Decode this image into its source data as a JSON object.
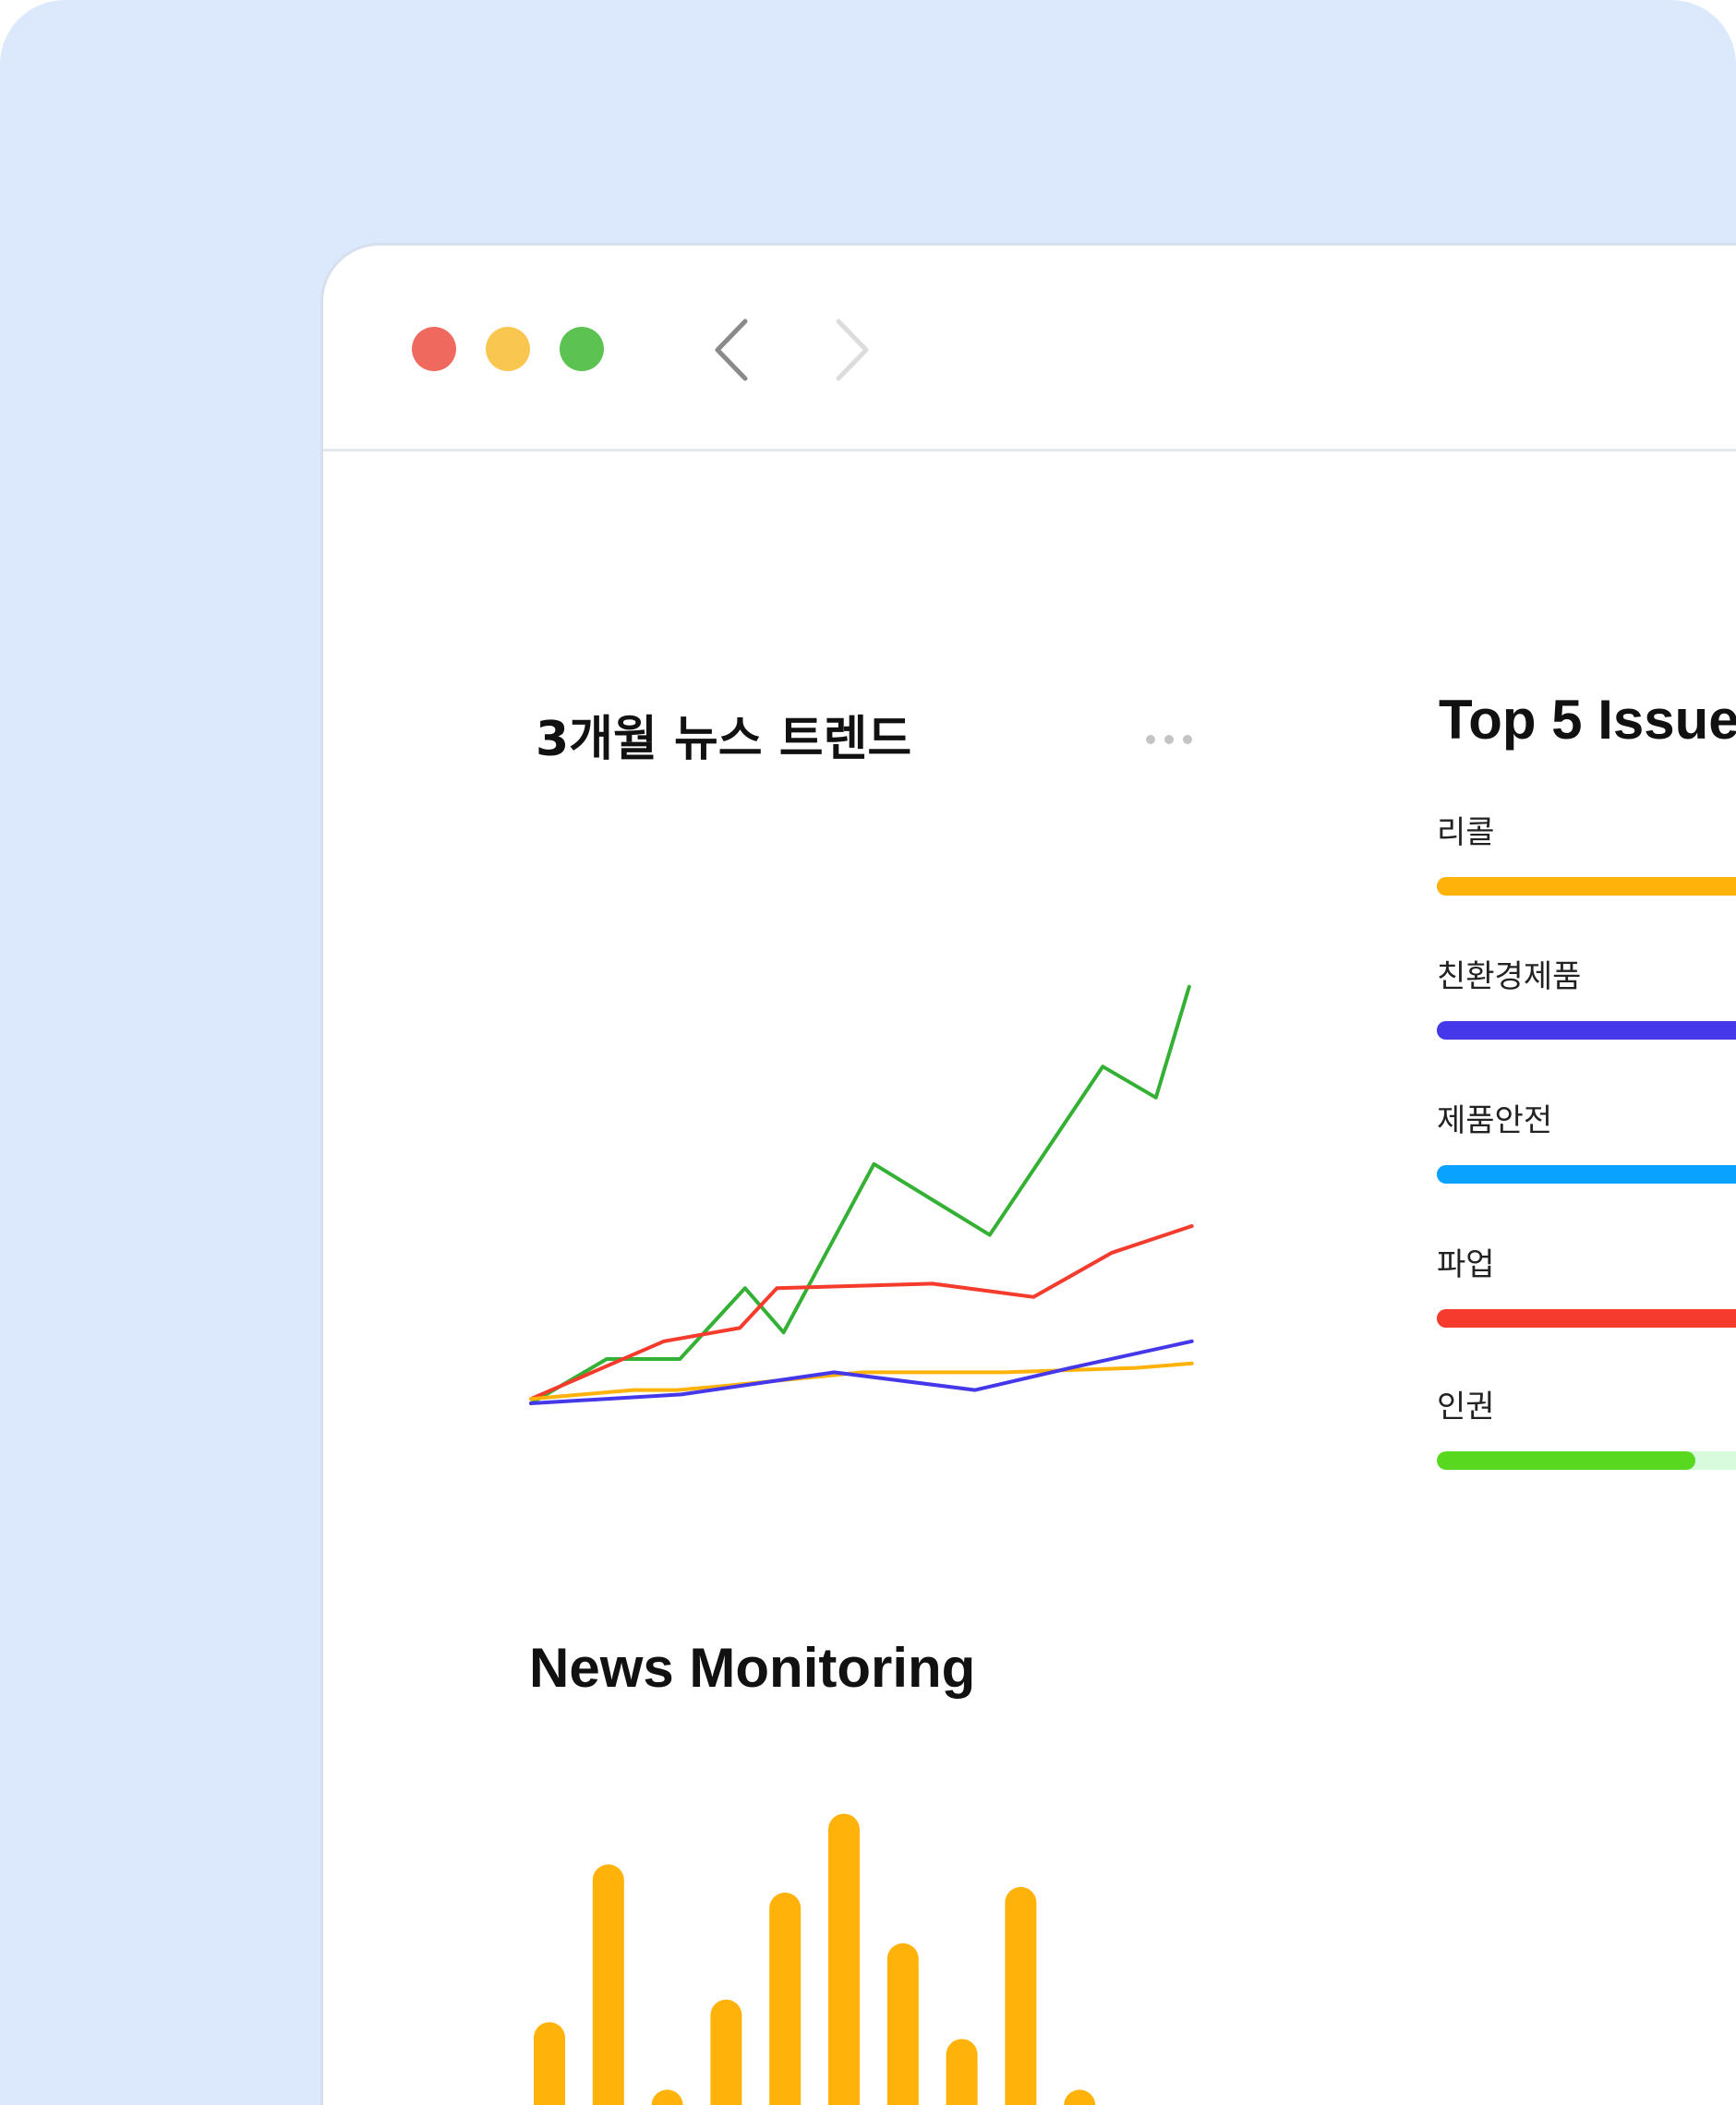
{
  "colors": {
    "background": "#dce9fd",
    "window": "#ffffff",
    "close": "#f0695e",
    "minimize": "#f9c64f",
    "maximize": "#5cc352"
  },
  "toolbar": {
    "back_icon": "chevron-left-icon",
    "forward_icon": "chevron-right-icon",
    "more_icon": "more-horizontal-icon"
  },
  "trend": {
    "title": "3개월 뉴스 트렌드"
  },
  "top5": {
    "title": "Top 5 Issue",
    "items": [
      {
        "label": "리콜",
        "color": "#ffb20a",
        "track": "#ffb20a",
        "value": 1.0
      },
      {
        "label": "친환경제품",
        "color": "#4538ea",
        "track": "#4538ea",
        "value": 1.0
      },
      {
        "label": "제품안전",
        "color": "#0aa2ff",
        "track": "#0aa2ff",
        "value": 1.0
      },
      {
        "label": "파업",
        "color": "#f43b2c",
        "track": "#f43b2c",
        "value": 1.0
      },
      {
        "label": "인권",
        "color": "#58d81f",
        "track": "#d8fadd",
        "value": 0.7
      }
    ]
  },
  "news": {
    "title": "News Monitoring"
  },
  "chart_data": [
    {
      "type": "line",
      "y_range": [
        0,
        100
      ],
      "series": [
        {
          "color": "#34b134",
          "x": [
            0,
            57,
            112,
            161,
            190,
            258,
            345,
            430,
            470,
            495
          ],
          "y": [
            0,
            10,
            10,
            26,
            16,
            54,
            38,
            76,
            69,
            94
          ]
        },
        {
          "color": "#f43b2c",
          "x": [
            0,
            100,
            157,
            185,
            302,
            378,
            437,
            497
          ],
          "y": [
            1,
            14,
            17,
            26,
            27,
            24,
            34,
            40
          ]
        },
        {
          "color": "#4538ea",
          "x": [
            0,
            113,
            228,
            334,
            406,
            497
          ],
          "y": [
            0,
            2,
            7,
            3,
            8,
            14
          ]
        },
        {
          "color": "#ffb20a",
          "x": [
            0,
            77,
            110,
            148,
            249,
            356,
            455,
            497
          ],
          "y": [
            1,
            3,
            3,
            4,
            7,
            7,
            8,
            9
          ]
        }
      ]
    },
    {
      "type": "bar",
      "color": "#ffb20a",
      "values": [
        18,
        46,
        6,
        22,
        41,
        55,
        32,
        15,
        42,
        6
      ],
      "y_range": [
        0,
        60
      ]
    }
  ]
}
